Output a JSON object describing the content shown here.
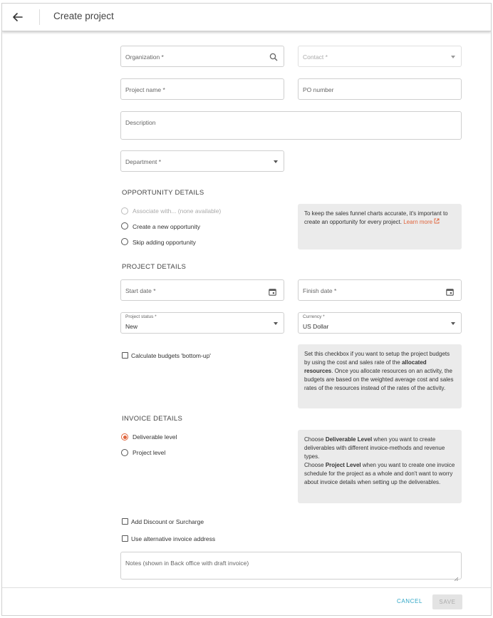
{
  "header": {
    "title": "Create project"
  },
  "form": {
    "organization_placeholder": "Organization *",
    "contact_placeholder": "Contact *",
    "project_name_placeholder": "Project name *",
    "po_number_placeholder": "PO number",
    "description_placeholder": "Description",
    "department_placeholder": "Department *"
  },
  "opportunity": {
    "title": "OPPORTUNITY DETAILS",
    "options": [
      {
        "label": "Associate with... (none available)",
        "state": "disabled"
      },
      {
        "label": "Create a new opportunity",
        "state": "unchecked"
      },
      {
        "label": "Skip adding opportunity",
        "state": "unchecked"
      }
    ],
    "info_text": "To keep the sales funnel charts accurate, it's important to create an opportunity for every project.",
    "info_link": "Learn more"
  },
  "project_details": {
    "title": "PROJECT DETAILS",
    "start_date_placeholder": "Start date *",
    "finish_date_placeholder": "Finish date *",
    "status_label": "Project status *",
    "status_value": "New",
    "currency_label": "Currency *",
    "currency_value": "US Dollar",
    "budget_checkbox_label": "Calculate budgets 'bottom-up'",
    "budget_info_1": "Set this checkbox if you want to setup the project budgets by using the cost and sales rate of the",
    "budget_info_bold": "allocated resources",
    "budget_info_2": ". Once you allocate resources on an activity, the budgets are based on the weighted average cost and sales rates of the resources instead of the rates of the activity."
  },
  "invoice": {
    "title": "INVOICE DETAILS",
    "options": [
      {
        "label": "Deliverable level",
        "state": "checked"
      },
      {
        "label": "Project level",
        "state": "unchecked"
      }
    ],
    "info_1a": "Choose",
    "info_1b": "Deliverable Level",
    "info_1c": "when you want to create deliverables with different invoice-methods and revenue types.",
    "info_2a": "Choose",
    "info_2b": "Project Level",
    "info_2c": "when you want to create one invoice schedule for the project as a whole and don't want to worry about invoice details when setting up the deliverables.",
    "discount_label": "Add Discount or Surcharge",
    "alt_address_label": "Use alternative invoice address",
    "notes_placeholder": "Notes (shown in Back office with draft invoice)"
  },
  "footer": {
    "cancel_label": "CANCEL",
    "save_label": "SAVE"
  },
  "colors": {
    "accent": "#e0643c",
    "link_blue": "#2fa6c6",
    "info_bg": "#ebebeb"
  }
}
